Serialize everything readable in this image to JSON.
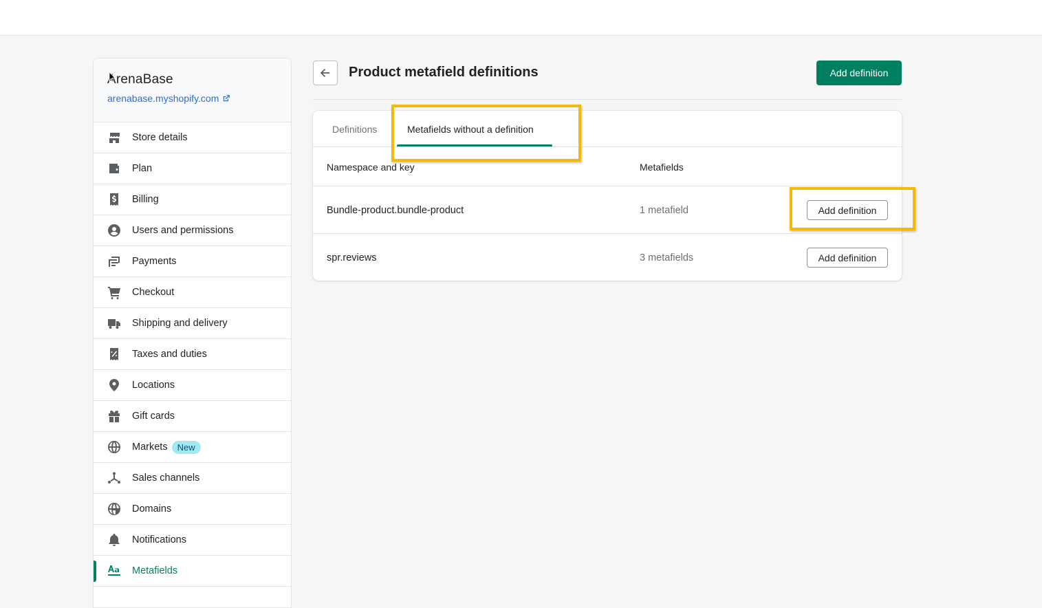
{
  "store": {
    "name": "ArenaBase",
    "url": "arenabase.myshopify.com"
  },
  "sidebar": {
    "items": [
      {
        "label": "Store details",
        "icon": "store-icon"
      },
      {
        "label": "Plan",
        "icon": "wallet-icon"
      },
      {
        "label": "Billing",
        "icon": "receipt-dollar-icon"
      },
      {
        "label": "Users and permissions",
        "icon": "user-circle-icon"
      },
      {
        "label": "Payments",
        "icon": "payments-icon"
      },
      {
        "label": "Checkout",
        "icon": "cart-icon"
      },
      {
        "label": "Shipping and delivery",
        "icon": "truck-icon"
      },
      {
        "label": "Taxes and duties",
        "icon": "tax-receipt-icon"
      },
      {
        "label": "Locations",
        "icon": "location-pin-icon"
      },
      {
        "label": "Gift cards",
        "icon": "gift-icon"
      },
      {
        "label": "Markets",
        "icon": "globe-icon",
        "badge": "New"
      },
      {
        "label": "Sales channels",
        "icon": "channels-icon"
      },
      {
        "label": "Domains",
        "icon": "domain-globe-icon"
      },
      {
        "label": "Notifications",
        "icon": "bell-icon"
      },
      {
        "label": "Metafields",
        "icon": "metafields-icon",
        "active": true
      }
    ]
  },
  "header": {
    "title": "Product metafield definitions",
    "primary_action": "Add definition"
  },
  "tabs": [
    {
      "label": "Definitions",
      "selected": false
    },
    {
      "label": "Metafields without a definition",
      "selected": true
    }
  ],
  "table": {
    "columns": [
      "Namespace and key",
      "Metafields"
    ],
    "rows": [
      {
        "key": "Bundle-product.bundle-product",
        "count": "1 metafield",
        "action": "Add definition"
      },
      {
        "key": "spr.reviews",
        "count": "3 metafields",
        "action": "Add definition"
      }
    ]
  },
  "colors": {
    "accent": "#008060",
    "highlight": "#f5b90a",
    "link": "#2c6ecb",
    "badge_bg": "#a4e8f2"
  }
}
